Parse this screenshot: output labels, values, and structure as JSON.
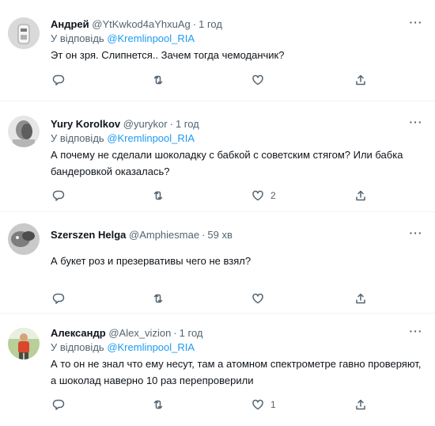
{
  "tweets": [
    {
      "name": "Андрей",
      "handle": "@YtKwkod4aYhxuAg",
      "time": "1 год",
      "reply_prefix": "У відповідь",
      "reply_to": "@Kremlinpool_RIA",
      "text": "Эт он зря. Слипнется.. Зачем тогда чемоданчик?",
      "like_count": ""
    },
    {
      "name": "Yury Korolkov",
      "handle": "@yurykor",
      "time": "1 год",
      "reply_prefix": "У відповідь",
      "reply_to": "@Kremlinpool_RIA",
      "text": "А почему не сделали шоколадку с бабкой с советским стягом? Или бабка бандеровкой оказалась?",
      "like_count": "2"
    },
    {
      "name": "Szerszen Helga",
      "handle": "@Amphiesmae",
      "time": "59 хв",
      "text": "А букет роз и презервативы чего не взял?",
      "like_count": ""
    },
    {
      "name": "Александр",
      "handle": "@Alex_vizion",
      "time": "1 год",
      "reply_prefix": "У відповідь",
      "reply_to": "@Kremlinpool_RIA",
      "text": "А то он не знал что ему несут, там а атомном спектрометре гавно проверяют, а шоколад наверно 10 раз перепроверили",
      "like_count": "1"
    }
  ],
  "dot": "·",
  "more": "···",
  "icons": {
    "reply": "reply-icon",
    "retweet": "retweet-icon",
    "like": "heart-icon",
    "share": "share-icon",
    "more": "more-icon"
  }
}
